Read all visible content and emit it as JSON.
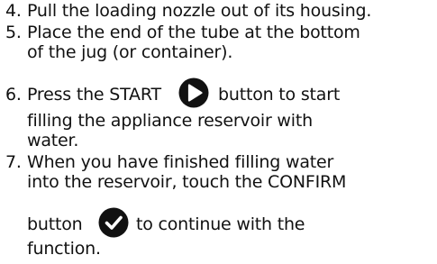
{
  "steps": [
    {
      "number": "4.",
      "lines": [
        "Pull the loading nozzle out of its housing."
      ]
    },
    {
      "number": "5.",
      "lines": [
        "Place the end of the tube at the bottom",
        "of the jug (or container)."
      ]
    },
    {
      "number": "6.",
      "line1_before_icon": "Press the START",
      "line1_after_icon": "button to start",
      "line2": "filling the appliance reservoir with",
      "line3": "water.",
      "icon": "play-icon"
    },
    {
      "number": "7.",
      "line1": "When you have finished filling water",
      "line2": "into the reservoir, touch the CONFIRM",
      "line3_before_icon": "button",
      "line3_after_icon": "to continue with the",
      "line4": "function.",
      "icon": "checkmark-icon"
    }
  ],
  "colors": {
    "text": "#111111",
    "icon_fill": "#111111",
    "icon_glyph": "#ffffff"
  }
}
